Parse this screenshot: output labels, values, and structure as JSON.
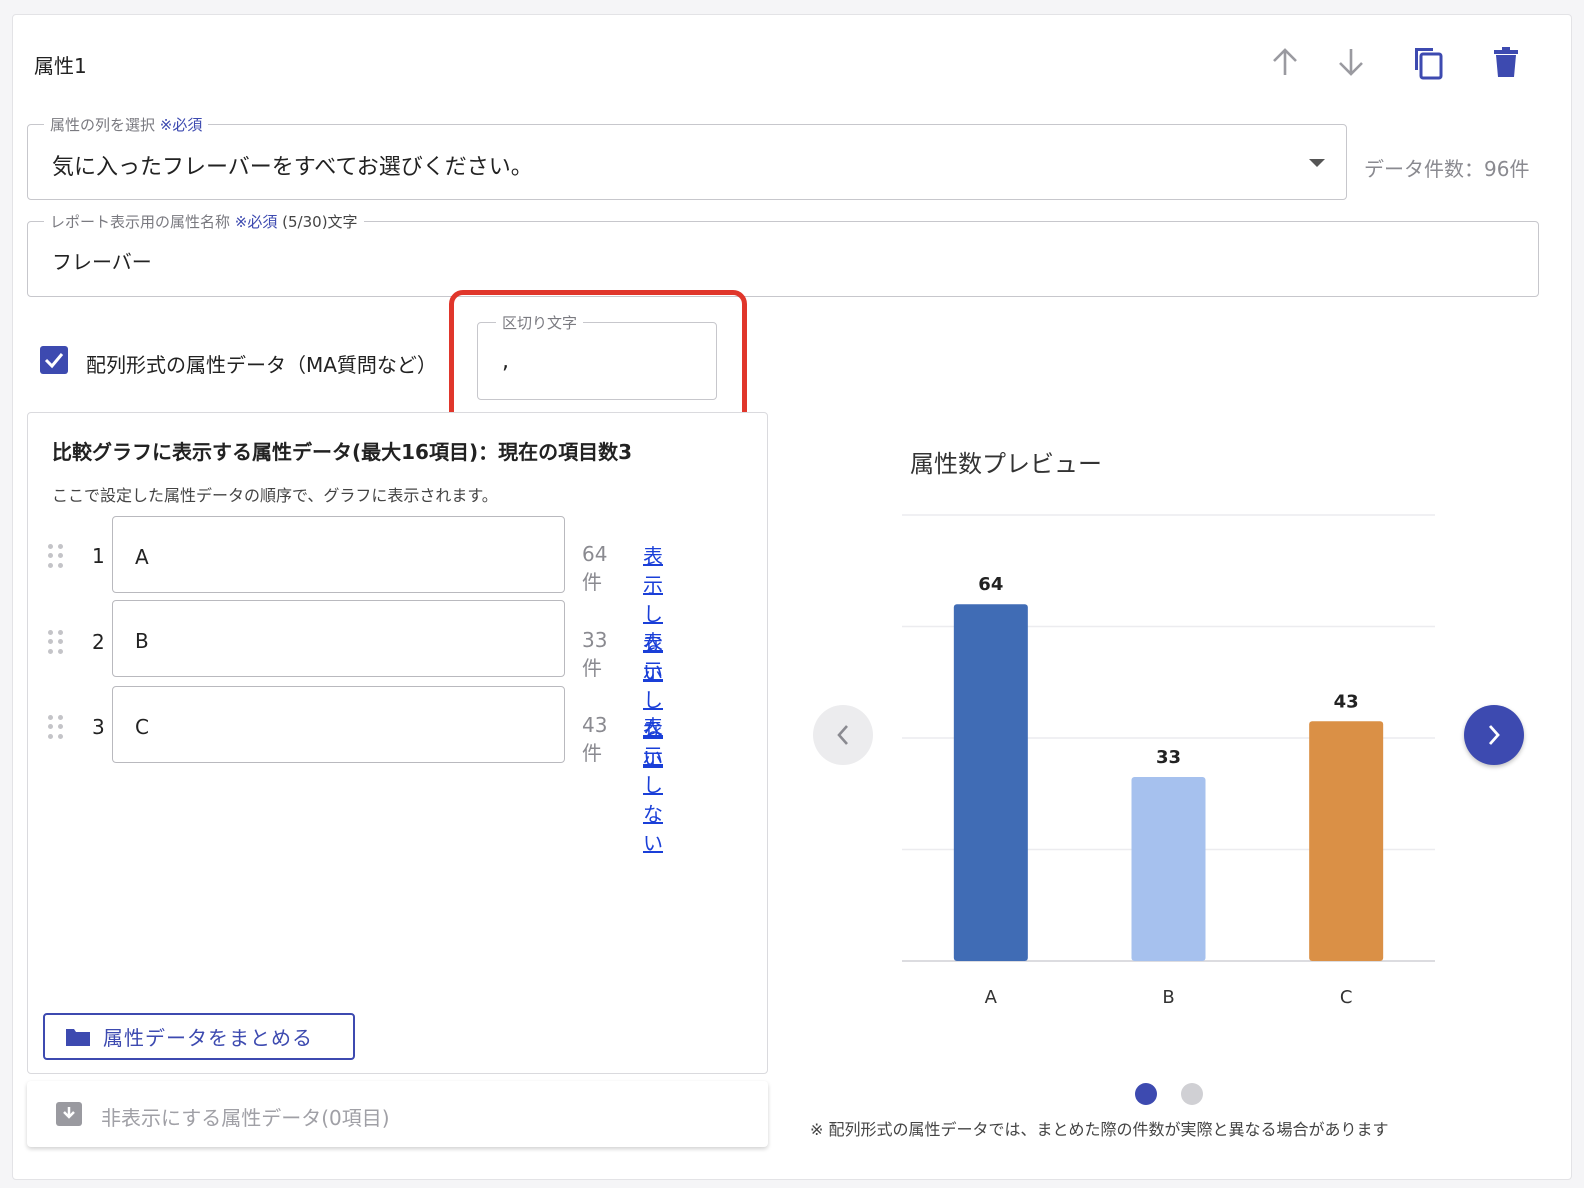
{
  "header": {
    "title": "属性1"
  },
  "column_select": {
    "legend": "属性の列を選択",
    "required": "※必須",
    "value": "気に入ったフレーバーをすべてお選びください。",
    "data_count": "データ件数：96件"
  },
  "report_name": {
    "legend": "レポート表示用の属性名称",
    "required": "※必須",
    "counter": "(5/30)文字",
    "value": "フレーバー"
  },
  "array_option": {
    "checkbox_label": "配列形式の属性データ（MA質問など）",
    "checked": true
  },
  "delimiter": {
    "legend": "区切り文字",
    "value": ","
  },
  "compare_panel": {
    "heading": "比較グラフに表示する属性データ(最大16項目)：現在の項目数3",
    "note": "ここで設定した属性データの順序で、グラフに表示されます。",
    "items": [
      {
        "index": "1",
        "value": "A",
        "count": "64件",
        "hide_label": "表示しない"
      },
      {
        "index": "2",
        "value": "B",
        "count": "33件",
        "hide_label": "表示しない"
      },
      {
        "index": "3",
        "value": "C",
        "count": "43件",
        "hide_label": "表示しない"
      }
    ],
    "group_button": "属性データをまとめる"
  },
  "hidden_panel": {
    "label": "非表示にする属性データ(0項目)"
  },
  "preview": {
    "title": "属性数プレビュー",
    "footnote": "※ 配列形式の属性データでは、まとめた際の件数が実際と異なる場合があります",
    "active_page": 1,
    "page_count": 2
  },
  "chart_data": {
    "type": "bar",
    "categories": [
      "A",
      "B",
      "C"
    ],
    "values": [
      64,
      33,
      43
    ],
    "ylim": [
      0,
      80
    ],
    "grid": true,
    "colors": [
      "#406cb5",
      "#a6c1ee",
      "#da9046"
    ],
    "data_labels": [
      "64",
      "33",
      "43"
    ]
  },
  "colors": {
    "accent": "#3d4ab0",
    "highlight": "#e0362b"
  },
  "icons": [
    "arrow-up-icon",
    "arrow-down-icon",
    "copy-icon",
    "trash-icon",
    "checkbox-icon",
    "dropdown-arrow-icon",
    "drag-handle-icon",
    "folder-icon",
    "archive-icon",
    "chevron-left-icon",
    "chevron-right-icon"
  ]
}
